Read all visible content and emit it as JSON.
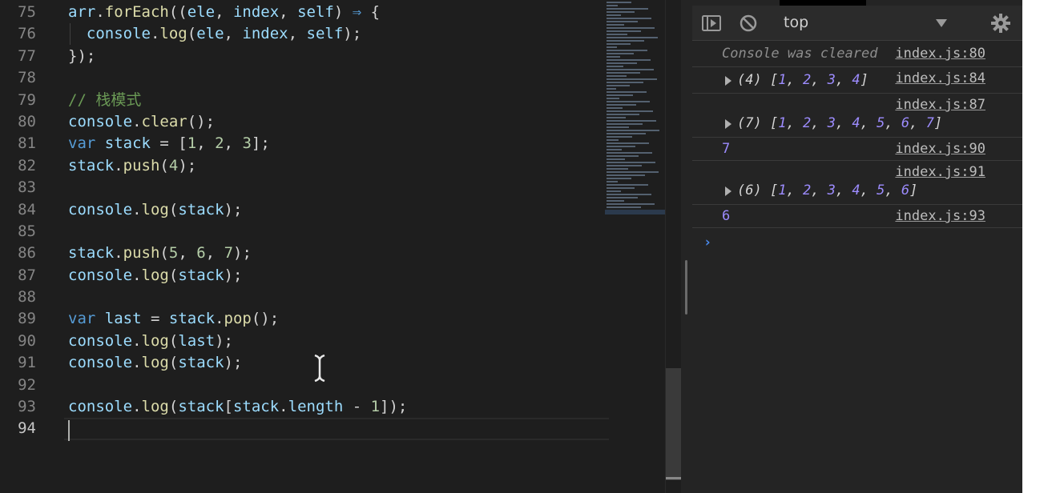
{
  "editor": {
    "lines": [
      {
        "n": "75",
        "tokens": [
          [
            "t-var",
            "arr"
          ],
          [
            "t-punc",
            "."
          ],
          [
            "t-fn",
            "forEach"
          ],
          [
            "t-punc",
            "(("
          ],
          [
            "t-var",
            "ele"
          ],
          [
            "t-punc",
            ", "
          ],
          [
            "t-var",
            "index"
          ],
          [
            "t-punc",
            ", "
          ],
          [
            "t-var",
            "self"
          ],
          [
            "t-punc",
            ") "
          ],
          [
            "t-kw",
            "⇒"
          ],
          [
            "t-punc",
            " {"
          ]
        ]
      },
      {
        "n": "76",
        "tokens": [
          [
            "t-punc",
            "  "
          ],
          [
            "t-var",
            "console"
          ],
          [
            "t-punc",
            "."
          ],
          [
            "t-fn",
            "log"
          ],
          [
            "t-punc",
            "("
          ],
          [
            "t-var",
            "ele"
          ],
          [
            "t-punc",
            ", "
          ],
          [
            "t-var",
            "index"
          ],
          [
            "t-punc",
            ", "
          ],
          [
            "t-var",
            "self"
          ],
          [
            "t-punc",
            ");"
          ]
        ]
      },
      {
        "n": "77",
        "tokens": [
          [
            "t-punc",
            "});"
          ]
        ]
      },
      {
        "n": "78",
        "tokens": []
      },
      {
        "n": "79",
        "tokens": [
          [
            "t-cmt",
            "// 栈模式"
          ]
        ]
      },
      {
        "n": "80",
        "tokens": [
          [
            "t-var",
            "console"
          ],
          [
            "t-punc",
            "."
          ],
          [
            "t-fn",
            "clear"
          ],
          [
            "t-punc",
            "();"
          ]
        ]
      },
      {
        "n": "81",
        "tokens": [
          [
            "t-kw",
            "var"
          ],
          [
            "t-punc",
            " "
          ],
          [
            "t-var",
            "stack"
          ],
          [
            "t-punc",
            " = ["
          ],
          [
            "t-num",
            "1"
          ],
          [
            "t-punc",
            ", "
          ],
          [
            "t-num",
            "2"
          ],
          [
            "t-punc",
            ", "
          ],
          [
            "t-num",
            "3"
          ],
          [
            "t-punc",
            "];"
          ]
        ]
      },
      {
        "n": "82",
        "tokens": [
          [
            "t-var",
            "stack"
          ],
          [
            "t-punc",
            "."
          ],
          [
            "t-fn",
            "push"
          ],
          [
            "t-punc",
            "("
          ],
          [
            "t-num",
            "4"
          ],
          [
            "t-punc",
            ");"
          ]
        ]
      },
      {
        "n": "83",
        "tokens": []
      },
      {
        "n": "84",
        "tokens": [
          [
            "t-var",
            "console"
          ],
          [
            "t-punc",
            "."
          ],
          [
            "t-fn",
            "log"
          ],
          [
            "t-punc",
            "("
          ],
          [
            "t-var",
            "stack"
          ],
          [
            "t-punc",
            ");"
          ]
        ]
      },
      {
        "n": "85",
        "tokens": []
      },
      {
        "n": "86",
        "tokens": [
          [
            "t-var",
            "stack"
          ],
          [
            "t-punc",
            "."
          ],
          [
            "t-fn",
            "push"
          ],
          [
            "t-punc",
            "("
          ],
          [
            "t-num",
            "5"
          ],
          [
            "t-punc",
            ", "
          ],
          [
            "t-num",
            "6"
          ],
          [
            "t-punc",
            ", "
          ],
          [
            "t-num",
            "7"
          ],
          [
            "t-punc",
            ");"
          ]
        ]
      },
      {
        "n": "87",
        "tokens": [
          [
            "t-var",
            "console"
          ],
          [
            "t-punc",
            "."
          ],
          [
            "t-fn",
            "log"
          ],
          [
            "t-punc",
            "("
          ],
          [
            "t-var",
            "stack"
          ],
          [
            "t-punc",
            ");"
          ]
        ]
      },
      {
        "n": "88",
        "tokens": []
      },
      {
        "n": "89",
        "tokens": [
          [
            "t-kw",
            "var"
          ],
          [
            "t-punc",
            " "
          ],
          [
            "t-var",
            "last"
          ],
          [
            "t-punc",
            " = "
          ],
          [
            "t-var",
            "stack"
          ],
          [
            "t-punc",
            "."
          ],
          [
            "t-fn",
            "pop"
          ],
          [
            "t-punc",
            "();"
          ]
        ]
      },
      {
        "n": "90",
        "tokens": [
          [
            "t-var",
            "console"
          ],
          [
            "t-punc",
            "."
          ],
          [
            "t-fn",
            "log"
          ],
          [
            "t-punc",
            "("
          ],
          [
            "t-var",
            "last"
          ],
          [
            "t-punc",
            ");"
          ]
        ]
      },
      {
        "n": "91",
        "tokens": [
          [
            "t-var",
            "console"
          ],
          [
            "t-punc",
            "."
          ],
          [
            "t-fn",
            "log"
          ],
          [
            "t-punc",
            "("
          ],
          [
            "t-var",
            "stack"
          ],
          [
            "t-punc",
            ");"
          ]
        ]
      },
      {
        "n": "92",
        "tokens": []
      },
      {
        "n": "93",
        "tokens": [
          [
            "t-var",
            "console"
          ],
          [
            "t-punc",
            "."
          ],
          [
            "t-fn",
            "log"
          ],
          [
            "t-punc",
            "("
          ],
          [
            "t-var",
            "stack"
          ],
          [
            "t-punc",
            "["
          ],
          [
            "t-var",
            "stack"
          ],
          [
            "t-punc",
            "."
          ],
          [
            "t-var",
            "length"
          ],
          [
            "t-punc",
            " - "
          ],
          [
            "t-num",
            "1"
          ],
          [
            "t-punc",
            "]);"
          ]
        ]
      },
      {
        "n": "94",
        "tokens": [],
        "current": true
      }
    ]
  },
  "console": {
    "context": "top",
    "toolbar_icons": [
      "sidebar-toggle-icon",
      "clear-console-icon",
      "settings-gear-icon"
    ],
    "messages": [
      {
        "kind": "cleared",
        "text": "Console was cleared",
        "source": "index.js:80"
      },
      {
        "kind": "array",
        "count": "(4)",
        "values": [
          "1",
          "2",
          "3",
          "4"
        ],
        "source": "index.js:84"
      },
      {
        "kind": "array",
        "count": "(7)",
        "values": [
          "1",
          "2",
          "3",
          "4",
          "5",
          "6",
          "7"
        ],
        "source": "index.js:87",
        "source_above": true
      },
      {
        "kind": "number",
        "value": "7",
        "source": "index.js:90"
      },
      {
        "kind": "array",
        "count": "(6)",
        "values": [
          "1",
          "2",
          "3",
          "4",
          "5",
          "6"
        ],
        "source": "index.js:91",
        "source_above": true
      },
      {
        "kind": "number",
        "value": "6",
        "source": "index.js:93"
      }
    ],
    "prompt": "›"
  },
  "colors": {
    "editor_bg": "#1e1e1e",
    "console_bg": "#242424",
    "number_value": "#9d8cff",
    "prompt": "#4a8cf0"
  }
}
